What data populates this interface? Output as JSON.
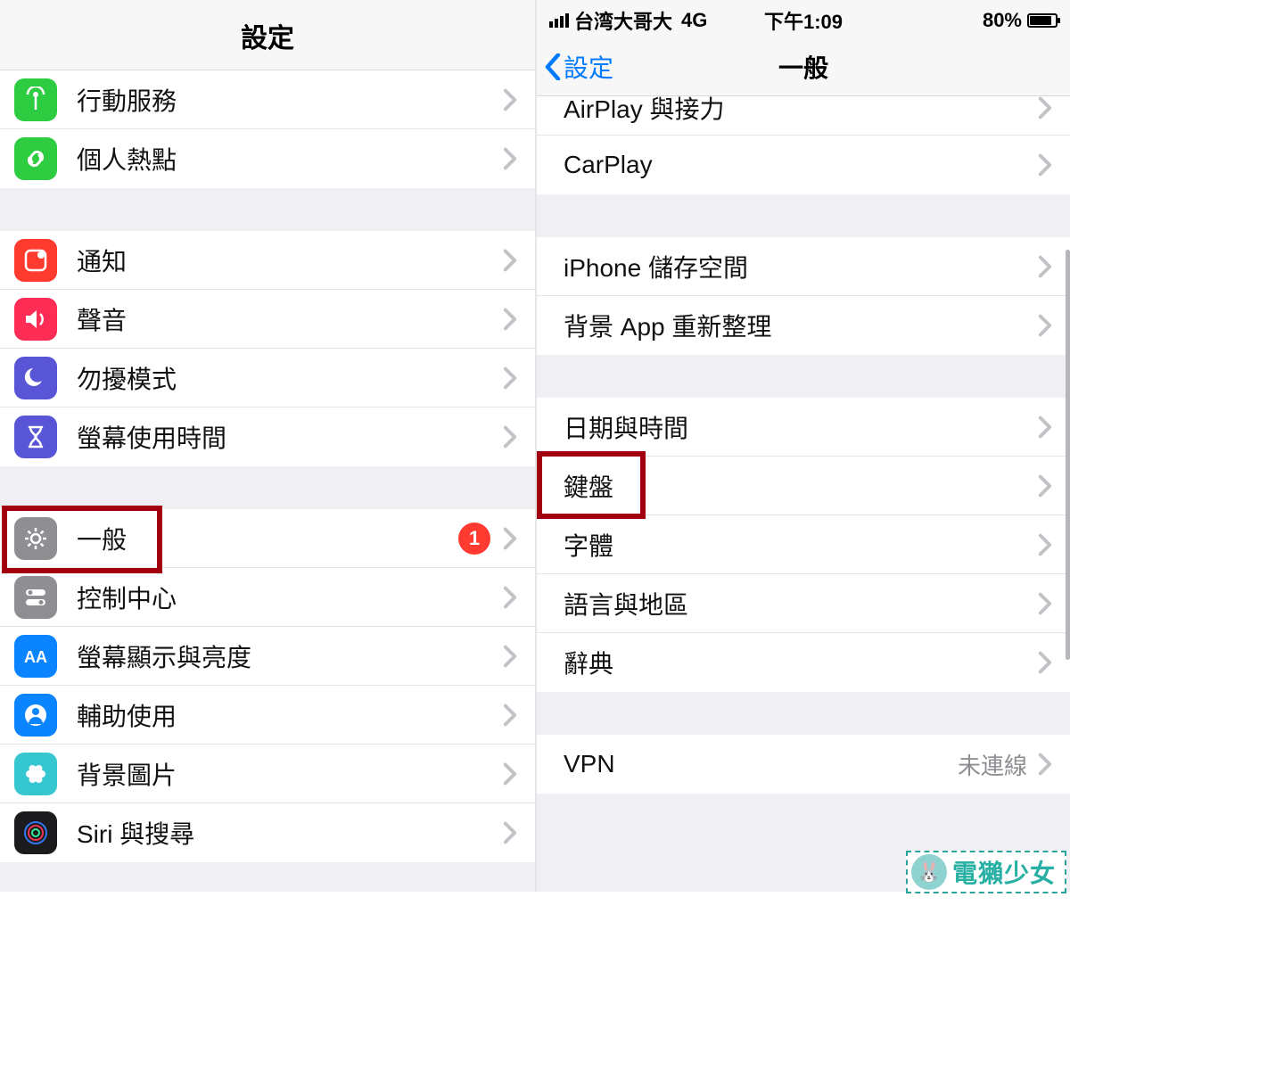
{
  "left": {
    "title": "設定",
    "groups": [
      [
        {
          "id": "cellular",
          "label": "行動服務",
          "icon": "#2ecc40",
          "glyph": "antenna"
        },
        {
          "id": "hotspot",
          "label": "個人熱點",
          "icon": "#2ecc40",
          "glyph": "link"
        }
      ],
      [
        {
          "id": "notifications",
          "label": "通知",
          "icon": "#ff3a2f",
          "glyph": "notif"
        },
        {
          "id": "sound",
          "label": "聲音",
          "icon": "#ff2d55",
          "glyph": "speaker"
        },
        {
          "id": "dnd",
          "label": "勿擾模式",
          "icon": "#5856d6",
          "glyph": "moon"
        },
        {
          "id": "screentime",
          "label": "螢幕使用時間",
          "icon": "#5856d6",
          "glyph": "hourglass"
        }
      ],
      [
        {
          "id": "general",
          "label": "一般",
          "icon": "#8e8e93",
          "glyph": "gear",
          "badge": "1",
          "highlight": true
        },
        {
          "id": "controlcenter",
          "label": "控制中心",
          "icon": "#8e8e93",
          "glyph": "toggles"
        },
        {
          "id": "display",
          "label": "螢幕顯示與亮度",
          "icon": "#0a84ff",
          "glyph": "aa"
        },
        {
          "id": "accessibility",
          "label": "輔助使用",
          "icon": "#0a84ff",
          "glyph": "person"
        },
        {
          "id": "wallpaper",
          "label": "背景圖片",
          "icon": "#36c6d0",
          "glyph": "flower"
        },
        {
          "id": "siri",
          "label": "Siri 與搜尋",
          "icon": "#1b1b1d",
          "glyph": "siri"
        }
      ]
    ]
  },
  "right": {
    "status": {
      "carrier": "台湾大哥大",
      "network": "4G",
      "time": "下午1:09",
      "battery": "80%"
    },
    "nav": {
      "back": "設定",
      "title": "一般"
    },
    "crop_row": {
      "label": "AirPlay 與接力"
    },
    "groups": [
      [
        {
          "id": "carplay",
          "label": "CarPlay"
        }
      ],
      [
        {
          "id": "storage",
          "label": "iPhone 儲存空間"
        },
        {
          "id": "bgrefresh",
          "label": "背景 App 重新整理"
        }
      ],
      [
        {
          "id": "datetime",
          "label": "日期與時間"
        },
        {
          "id": "keyboard",
          "label": "鍵盤",
          "highlight": true
        },
        {
          "id": "fonts",
          "label": "字體"
        },
        {
          "id": "langregion",
          "label": "語言與地區"
        },
        {
          "id": "dictionary",
          "label": "辭典"
        }
      ],
      [
        {
          "id": "vpn",
          "label": "VPN",
          "value": "未連線"
        }
      ]
    ]
  },
  "watermark": "電獺少女"
}
